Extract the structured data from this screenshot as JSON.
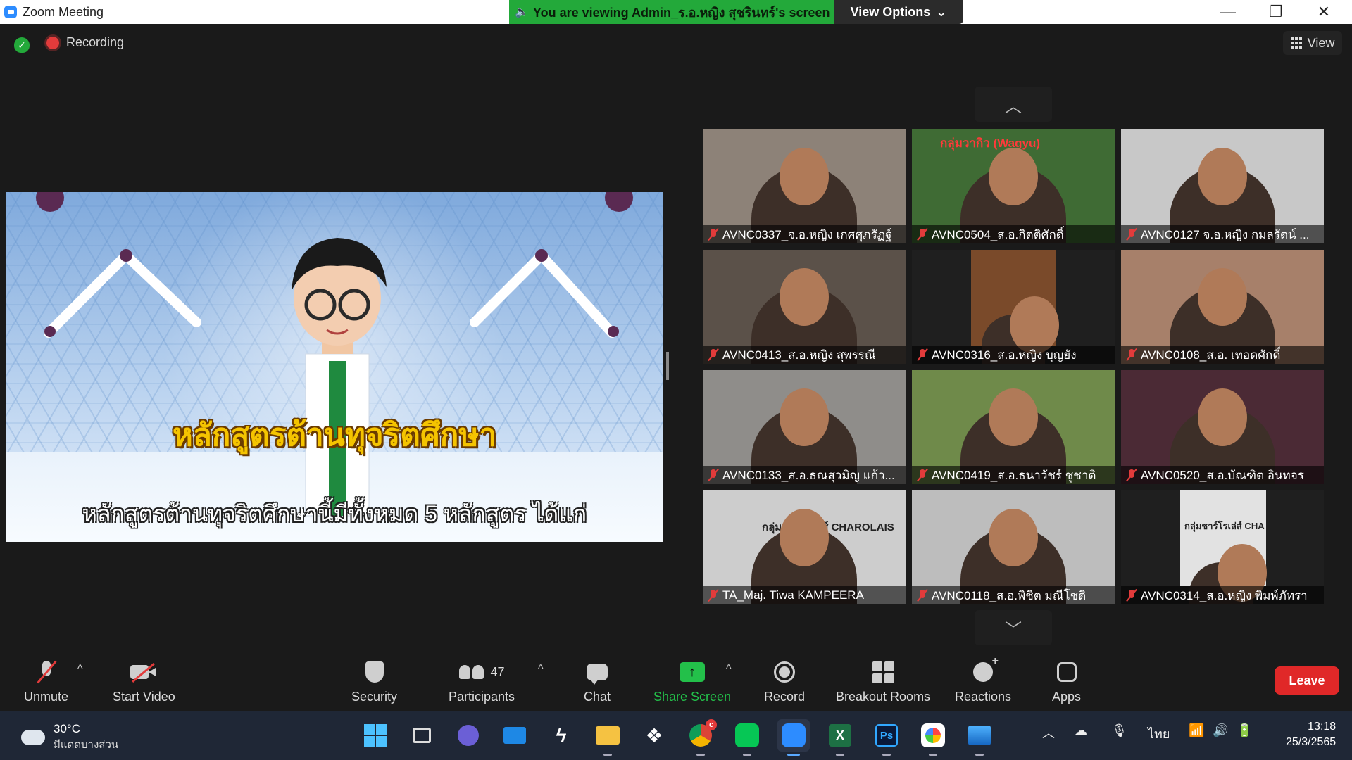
{
  "window": {
    "title": "Zoom Meeting",
    "share_banner": "You are viewing Admin_ร.อ.หญิง สุชรินทร์'s screen",
    "view_options": "View Options",
    "controls": [
      "—",
      "❐",
      "✕"
    ]
  },
  "meeting": {
    "recording_label": "Recording",
    "view_label": "View",
    "colors": {
      "secure": "#23a93a",
      "recording": "#e23b3b",
      "leave": "#e02828",
      "share": "#23c04a"
    }
  },
  "shared_screen": {
    "title": "หลักสูตรต้านทุจริตศึกษา",
    "subtitle": "หลักสูตรต้านทุจริตศึกษานี้มีทั้งหมด 5 หลักสูตร ได้แก่"
  },
  "gallery": {
    "participants": [
      {
        "name": "AVNC0337_จ.อ.หญิง เกศศุภรัฏฐ์",
        "bg": "#8d8278"
      },
      {
        "name": "AVNC0504_ส.อ.กิตติศักดิ์",
        "bg": "#3f6b34",
        "overlay": "กลุ่มวากิว (Wagyu)"
      },
      {
        "name": "AVNC0127 จ.อ.หญิง กมลรัตน์ ...",
        "bg": "#c8c8c8"
      },
      {
        "name": "AVNC0413_ส.อ.หญิง สุพรรณี",
        "bg": "#5b5149"
      },
      {
        "name": "AVNC0316_ส.อ.หญิง บุญยัง",
        "bg": "#1f1f1f"
      },
      {
        "name": "AVNC0108_ส.อ. เทอดศักดิ์",
        "bg": "#a7806a"
      },
      {
        "name": "AVNC0133_ส.อ.ธณสุวมิญ แก้ว...",
        "bg": "#8f8d8a"
      },
      {
        "name": "AVNC0419_ส.อ.ธนาวัชร์ ชูชาติ",
        "bg": "#6f8a4a"
      },
      {
        "name": "AVNC0520_ส.อ.บัณฑิต อินทจร",
        "bg": "#4b2a35"
      },
      {
        "name": "TA_Maj. Tiwa KAMPEERA",
        "bg": "#cdcdcd",
        "overlay": "กลุ่มชาร์โรเล่ส์ CHAROLAIS"
      },
      {
        "name": "AVNC0118_ส.อ.พิชิต มณีโชติ",
        "bg": "#bdbdbd"
      },
      {
        "name": "AVNC0314_ส.อ.หญิง พิมพ์ภัทรา",
        "bg": "#1f1f1f",
        "overlay": "กลุ่มชาร์โรเล่ส์ CHA"
      }
    ]
  },
  "toolbar": {
    "unmute": "Unmute",
    "start_video": "Start Video",
    "security": "Security",
    "participants": "Participants",
    "participants_count": "47",
    "chat": "Chat",
    "share_screen": "Share Screen",
    "record": "Record",
    "breakout": "Breakout Rooms",
    "reactions": "Reactions",
    "apps": "Apps",
    "leave": "Leave"
  },
  "taskbar": {
    "weather_temp": "30°C",
    "weather_cond": "มีแดดบางส่วน",
    "language": "ไทย",
    "time": "13:18",
    "date": "25/3/2565",
    "chrome_badge": "c"
  }
}
